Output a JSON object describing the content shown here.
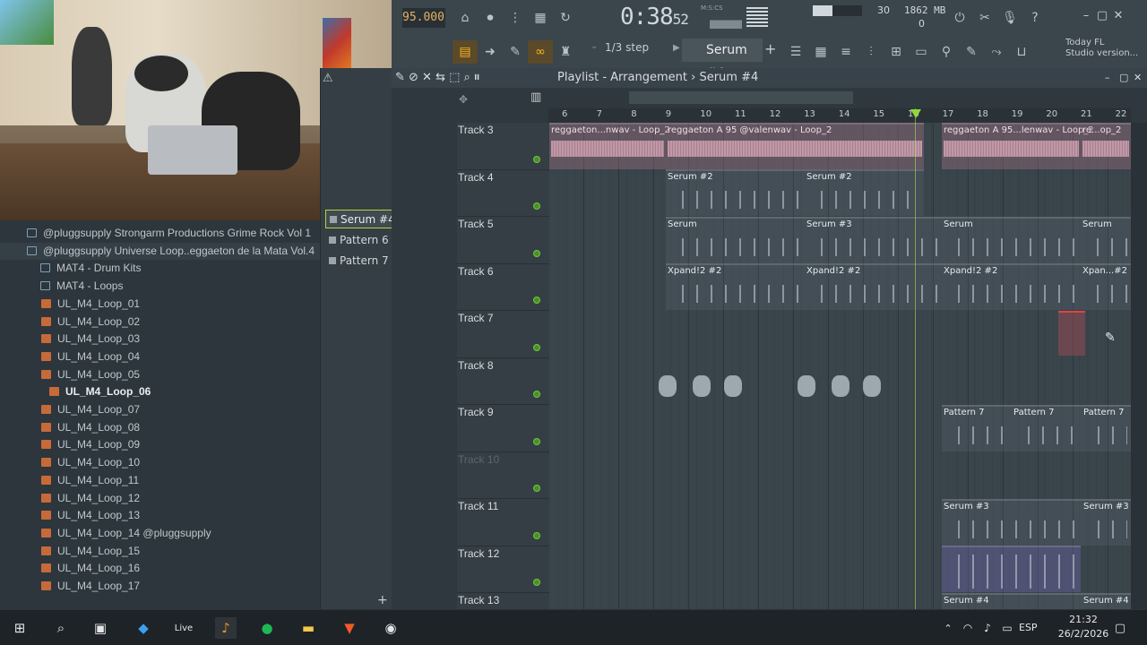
{
  "toolbar": {
    "bpm": "95.000",
    "time": "0:38",
    "time_sub": "52",
    "time_unit": "M:S:CS",
    "cpu": "30",
    "memory": "1862 MB",
    "polyphony": "0",
    "snap": "1/3 step",
    "pattern": "Serum #4",
    "news_line1": "Today  FL",
    "news_line2": "Studio version..."
  },
  "playlist": {
    "title": "Playlist - Arrangement",
    "separator": "›",
    "pattern": "Serum #4",
    "ruler": [
      "6",
      "7",
      "8",
      "9",
      "10",
      "11",
      "12",
      "13",
      "14",
      "15",
      "16",
      "17",
      "18",
      "19",
      "20",
      "21",
      "22"
    ],
    "tracks": [
      {
        "name": "Track 3",
        "muted": false
      },
      {
        "name": "Track 4",
        "muted": false
      },
      {
        "name": "Track 5",
        "muted": false
      },
      {
        "name": "Track 6",
        "muted": false
      },
      {
        "name": "Track 7",
        "muted": false
      },
      {
        "name": "Track 8",
        "muted": false
      },
      {
        "name": "Track 9",
        "muted": false
      },
      {
        "name": "Track 10",
        "muted": true
      },
      {
        "name": "Track 11",
        "muted": false
      },
      {
        "name": "Track 12",
        "muted": false
      },
      {
        "name": "Track 13",
        "muted": false
      }
    ],
    "clips": {
      "t3a": "reggaeton...nwav - Loop_2",
      "t3b": "reggaeton A 95 @valenwav - Loop_2",
      "t3c": "reggaeton A 95...lenwav - Loop_2",
      "t3d": "re...op_2",
      "t4a": "Serum #2",
      "t4b": "Serum #2",
      "t5a": "Serum",
      "t5b": "Serum #3",
      "t5c": "Serum",
      "t5d": "Serum",
      "t6a": "Xpand!2 #2",
      "t6b": "Xpand!2 #2",
      "t6c": "Xpand!2 #2",
      "t6d": "Xpan...#2",
      "t9a": "Pattern 7",
      "t9b": "Pattern 7",
      "t9c": "Pattern 7",
      "t11a": "Serum #3",
      "t11b": "Serum #3",
      "t13a": "Serum #4",
      "t13b": "Serum #4"
    }
  },
  "patterns": [
    "Serum #4",
    "Pattern 6",
    "Pattern 7"
  ],
  "browser": [
    {
      "label": "@pluggsupply Strongarm Productions Grime Rock Vol 1",
      "type": "folder",
      "indent": 1
    },
    {
      "label": "@pluggsupply Universe Loop..eggaeton de la Mata Vol.4",
      "type": "folder",
      "indent": 1
    },
    {
      "label": "MAT4 - Drum Kits",
      "type": "folder",
      "indent": 2
    },
    {
      "label": "MAT4 - Loops",
      "type": "folder",
      "indent": 2
    },
    {
      "label": "UL_M4_Loop_01",
      "type": "file",
      "indent": 3
    },
    {
      "label": "UL_M4_Loop_02",
      "type": "file",
      "indent": 3
    },
    {
      "label": "UL_M4_Loop_03",
      "type": "file",
      "indent": 3
    },
    {
      "label": "UL_M4_Loop_04",
      "type": "file",
      "indent": 3
    },
    {
      "label": "UL_M4_Loop_05",
      "type": "file",
      "indent": 3
    },
    {
      "label": "UL_M4_Loop_06",
      "type": "file",
      "indent": 4
    },
    {
      "label": "UL_M4_Loop_07",
      "type": "file",
      "indent": 3
    },
    {
      "label": "UL_M4_Loop_08",
      "type": "file",
      "indent": 3
    },
    {
      "label": "UL_M4_Loop_09",
      "type": "file",
      "indent": 3
    },
    {
      "label": "UL_M4_Loop_10",
      "type": "file",
      "indent": 3
    },
    {
      "label": "UL_M4_Loop_11",
      "type": "file",
      "indent": 3
    },
    {
      "label": "UL_M4_Loop_12",
      "type": "file",
      "indent": 3
    },
    {
      "label": "UL_M4_Loop_13",
      "type": "file",
      "indent": 3
    },
    {
      "label": "UL_M4_Loop_14 @pluggsupply",
      "type": "file",
      "indent": 3
    },
    {
      "label": "UL_M4_Loop_15",
      "type": "file",
      "indent": 3
    },
    {
      "label": "UL_M4_Loop_16",
      "type": "file",
      "indent": 3
    },
    {
      "label": "UL_M4_Loop_17",
      "type": "file",
      "indent": 3
    }
  ],
  "taskbar": {
    "language": "ESP",
    "time": "21:32",
    "date": "26/2/2026",
    "live_label": "Live"
  }
}
